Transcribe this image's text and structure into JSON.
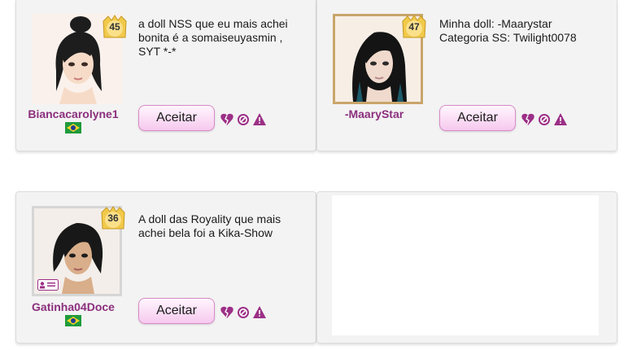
{
  "cards": [
    {
      "username": "Biancacarolyne1",
      "level": "45",
      "message": "a doll NSS que eu mais achei\nbonita é a somaiseuyasmin ,\nSYT *-*",
      "accept_label": "Aceitar",
      "flag": "brazil-flag-icon"
    },
    {
      "username": "-MaaryStar",
      "level": "47",
      "message": "Minha doll: -Maarystar\nCategoria SS: Twilight0078",
      "accept_label": "Aceitar"
    },
    {
      "username": "Gatinha04Doce",
      "level": "36",
      "message": "A doll das Royality que mais\nachei bela foi a Kika-Show",
      "accept_label": "Aceitar",
      "flag": "brazil-flag-icon"
    }
  ],
  "colors": {
    "username": "#8b2f7d",
    "action_icons": "#9c2f86",
    "button_border": "#d98ac8",
    "level_badge": "#f1c94a"
  },
  "icons": [
    "broken-heart-icon",
    "block-icon",
    "warning-icon",
    "crown-level-icon",
    "id-card-icon"
  ]
}
